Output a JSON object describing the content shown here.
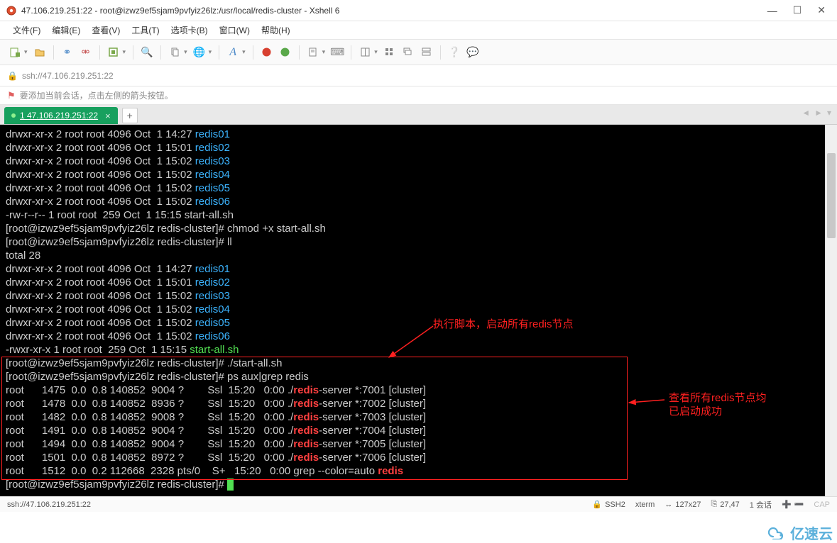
{
  "window": {
    "title": "47.106.219.251:22 - root@izwz9ef5sjam9pvfyiz26lz:/usr/local/redis-cluster - Xshell 6"
  },
  "menu": {
    "file": "文件(F)",
    "edit": "编辑(E)",
    "view": "查看(V)",
    "tools": "工具(T)",
    "tabs": "选项卡(B)",
    "window": "窗口(W)",
    "help": "帮助(H)"
  },
  "address": {
    "value": "ssh://47.106.219.251:22"
  },
  "hint": {
    "text": "要添加当前会话，点击左侧的箭头按钮。"
  },
  "tab": {
    "label": "1 47.106.219.251:22"
  },
  "annotations": {
    "a1": "执行脚本，启动所有redis节点",
    "a2_l1": "查看所有redis节点均",
    "a2_l2": "已启动成功"
  },
  "terminal": {
    "lines": [
      {
        "pre": "drwxr-xr-x 2 root root 4096 Oct  1 14:27 ",
        "hl": "redis01",
        "cls": "cyan"
      },
      {
        "pre": "drwxr-xr-x 2 root root 4096 Oct  1 15:01 ",
        "hl": "redis02",
        "cls": "cyan"
      },
      {
        "pre": "drwxr-xr-x 2 root root 4096 Oct  1 15:02 ",
        "hl": "redis03",
        "cls": "cyan"
      },
      {
        "pre": "drwxr-xr-x 2 root root 4096 Oct  1 15:02 ",
        "hl": "redis04",
        "cls": "cyan"
      },
      {
        "pre": "drwxr-xr-x 2 root root 4096 Oct  1 15:02 ",
        "hl": "redis05",
        "cls": "cyan"
      },
      {
        "pre": "drwxr-xr-x 2 root root 4096 Oct  1 15:02 ",
        "hl": "redis06",
        "cls": "cyan"
      },
      {
        "pre": "-rw-r--r-- 1 root root  259 Oct  1 15:15 start-all.sh"
      },
      {
        "pre": "[root@izwz9ef5sjam9pvfyiz26lz redis-cluster]# chmod +x start-all.sh"
      },
      {
        "pre": "[root@izwz9ef5sjam9pvfyiz26lz redis-cluster]# ll"
      },
      {
        "pre": "total 28"
      },
      {
        "pre": "drwxr-xr-x 2 root root 4096 Oct  1 14:27 ",
        "hl": "redis01",
        "cls": "cyan"
      },
      {
        "pre": "drwxr-xr-x 2 root root 4096 Oct  1 15:01 ",
        "hl": "redis02",
        "cls": "cyan"
      },
      {
        "pre": "drwxr-xr-x 2 root root 4096 Oct  1 15:02 ",
        "hl": "redis03",
        "cls": "cyan"
      },
      {
        "pre": "drwxr-xr-x 2 root root 4096 Oct  1 15:02 ",
        "hl": "redis04",
        "cls": "cyan"
      },
      {
        "pre": "drwxr-xr-x 2 root root 4096 Oct  1 15:02 ",
        "hl": "redis05",
        "cls": "cyan"
      },
      {
        "pre": "drwxr-xr-x 2 root root 4096 Oct  1 15:02 ",
        "hl": "redis06",
        "cls": "cyan"
      },
      {
        "pre": "-rwxr-xr-x 1 root root  259 Oct  1 15:15 ",
        "hl": "start-all.sh",
        "cls": "green"
      },
      {
        "pre": "[root@izwz9ef5sjam9pvfyiz26lz redis-cluster]# ./start-all.sh"
      },
      {
        "pre": "[root@izwz9ef5sjam9pvfyiz26lz redis-cluster]# ps aux|grep redis"
      }
    ],
    "ps": [
      {
        "a": "root      1475  0.0  0.8 140852  9004 ?        Ssl  15:20   0:00 ./",
        "r": "redis",
        "b": "-server *:7001 [cluster]"
      },
      {
        "a": "root      1478  0.0  0.8 140852  8936 ?        Ssl  15:20   0:00 ./",
        "r": "redis",
        "b": "-server *:7002 [cluster]"
      },
      {
        "a": "root      1482  0.0  0.8 140852  9008 ?        Ssl  15:20   0:00 ./",
        "r": "redis",
        "b": "-server *:7003 [cluster]"
      },
      {
        "a": "root      1491  0.0  0.8 140852  9004 ?        Ssl  15:20   0:00 ./",
        "r": "redis",
        "b": "-server *:7004 [cluster]"
      },
      {
        "a": "root      1494  0.0  0.8 140852  9004 ?        Ssl  15:20   0:00 ./",
        "r": "redis",
        "b": "-server *:7005 [cluster]"
      },
      {
        "a": "root      1501  0.0  0.8 140852  8972 ?        Ssl  15:20   0:00 ./",
        "r": "redis",
        "b": "-server *:7006 [cluster]"
      },
      {
        "a": "root      1512  0.0  0.2 112668  2328 pts/0    S+   15:20   0:00 grep --color=auto ",
        "r": "redis",
        "b": ""
      }
    ],
    "prompt": "[root@izwz9ef5sjam9pvfyiz26lz redis-cluster]# "
  },
  "status": {
    "left": "ssh://47.106.219.251:22",
    "ssh": "SSH2",
    "term": "xterm",
    "size": "127x27",
    "pos": "27,47",
    "sess": "1 会话",
    "cap": "CAP"
  },
  "watermark": {
    "text": "亿速云"
  }
}
